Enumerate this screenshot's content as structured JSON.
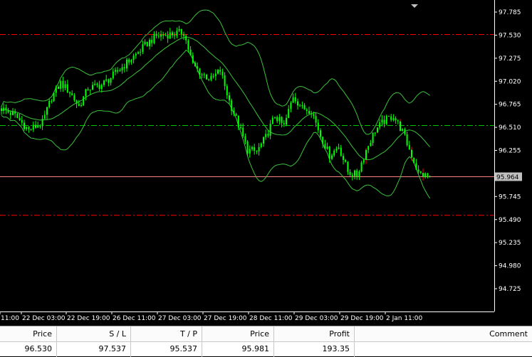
{
  "chart": {
    "price_axis": [
      "97.785",
      "97.530",
      "97.275",
      "97.020",
      "96.765",
      "96.510",
      "96.255",
      "95.745",
      "95.490",
      "95.235",
      "94.980",
      "94.725"
    ],
    "current_price_label": "95.964",
    "time_axis": [
      "11:00",
      "22 Dec 03:00",
      "22 Dec 19:00",
      "26 Dec 11:00",
      "27 Dec 03:00",
      "27 Dec 19:00",
      "28 Dec 11:00",
      "29 Dec 03:00",
      "29 Dec 19:00",
      "2 Jan 11:00"
    ],
    "colors": {
      "background": "#000000",
      "candle": "#00ff00",
      "bands": "#3cc13c",
      "stop_loss_line": "#ff0000",
      "take_profit_line": "#ff0000",
      "entry_line": "#00c800",
      "bid_line": "#ff8080",
      "recent_wicks": "#ff0000",
      "axis": "#ffffff"
    }
  },
  "order_table": {
    "columns": [
      {
        "header": "Price",
        "value": "96.530"
      },
      {
        "header": "S / L",
        "value": "97.537"
      },
      {
        "header": "T / P",
        "value": "95.537"
      },
      {
        "header": "Price",
        "value": "95.981"
      },
      {
        "header": "Profit",
        "value": "193.35"
      },
      {
        "header": "Comment",
        "value": ""
      }
    ]
  }
}
